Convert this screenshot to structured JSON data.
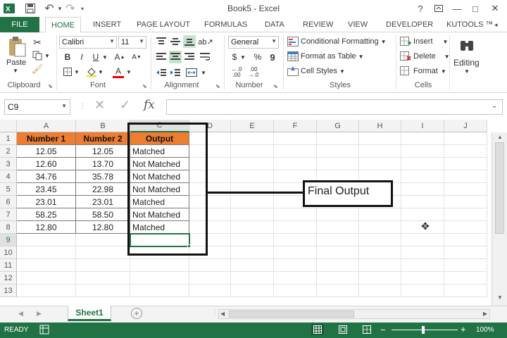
{
  "window": {
    "title": "Book5 - Excel",
    "help": "?",
    "minimize": "—",
    "maximize": "□",
    "close": "✕"
  },
  "qat": {
    "undo": "↶",
    "redo": "↷"
  },
  "tabs": [
    "FILE",
    "HOME",
    "INSERT",
    "PAGE LAYOUT",
    "FORMULAS",
    "DATA",
    "REVIEW",
    "VIEW",
    "DEVELOPER",
    "KUTOOLS ™"
  ],
  "ribbon": {
    "clipboard": {
      "label": "Clipboard",
      "paste": "Paste"
    },
    "font": {
      "label": "Font",
      "name": "Calibri",
      "size": "11",
      "bold": "B",
      "italic": "I",
      "underline": "U"
    },
    "alignment": {
      "label": "Alignment"
    },
    "number": {
      "label": "Number",
      "format": "General",
      "currency": "$",
      "percent": "%",
      "comma": "9"
    },
    "styles": {
      "label": "Styles",
      "conditional": "Conditional Formatting",
      "format_table": "Format as Table",
      "cell_styles": "Cell Styles"
    },
    "cells": {
      "label": "Cells",
      "insert": "Insert",
      "delete": "Delete",
      "format": "Format"
    },
    "editing": {
      "label": "Editing"
    }
  },
  "formula_bar": {
    "name_box": "C9",
    "fx": "fx",
    "content": ""
  },
  "columns": [
    "A",
    "B",
    "C",
    "D",
    "E",
    "F",
    "G",
    "H",
    "I",
    "J"
  ],
  "rows": [
    "1",
    "2",
    "3",
    "4",
    "5",
    "6",
    "7",
    "8",
    "9",
    "10",
    "11",
    "12",
    "13"
  ],
  "table": {
    "headers": [
      "Number 1",
      "Number 2",
      "Output"
    ],
    "data": [
      [
        "12.05",
        "12.05",
        "Matched"
      ],
      [
        "12.60",
        "13.70",
        "Not Matched"
      ],
      [
        "34.76",
        "35.78",
        "Not Matched"
      ],
      [
        "23.45",
        "22.98",
        "Not Matched"
      ],
      [
        "23.01",
        "23.01",
        "Matched"
      ],
      [
        "58.25",
        "58.50",
        "Not Matched"
      ],
      [
        "12.80",
        "12.80",
        "Matched"
      ]
    ]
  },
  "annotation": {
    "text": "Final Output"
  },
  "sheet_tab": "Sheet1",
  "status": {
    "ready": "READY",
    "zoom": "100%"
  },
  "colors": {
    "excel_green": "#217346",
    "header_fill": "#ed7d31"
  }
}
